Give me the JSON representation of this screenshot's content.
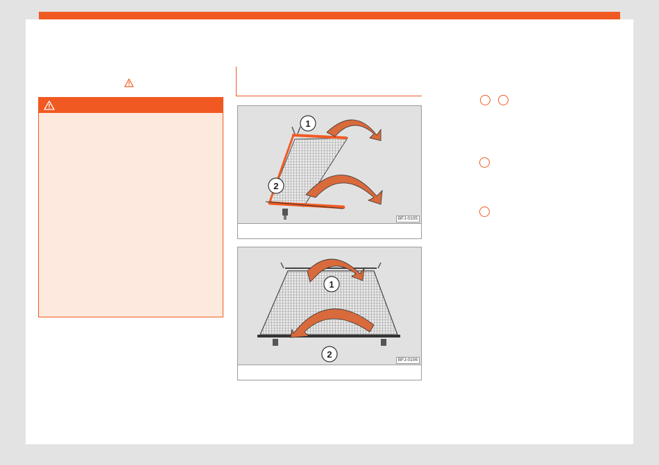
{
  "colors": {
    "accent": "#f05a22",
    "warning_bg": "#fde9dd",
    "page_bg": "#e3e3e3",
    "figure_bg": "#e1e1e1"
  },
  "icons": {
    "inline_warning": "warning-triangle-icon",
    "box_warning": "warning-triangle-icon"
  },
  "figures": [
    {
      "code": "BFJ-0105",
      "callouts": [
        "1",
        "2"
      ]
    },
    {
      "code": "BFJ-0106",
      "callouts": [
        "1",
        "2"
      ]
    }
  ]
}
